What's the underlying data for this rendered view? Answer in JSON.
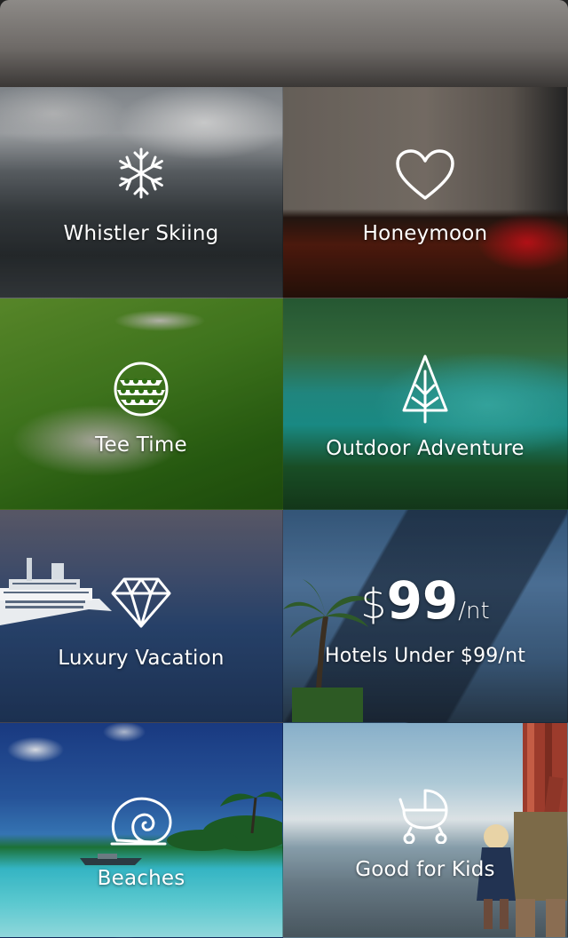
{
  "tiles": [
    {
      "id": "whistler",
      "label": "Whistler Skiing",
      "icon": "snowflake-icon"
    },
    {
      "id": "honeymoon",
      "label": "Honeymoon",
      "icon": "heart-icon"
    },
    {
      "id": "tee",
      "label": "Tee Time",
      "icon": "golf-ball-icon"
    },
    {
      "id": "outdoor",
      "label": "Outdoor Adventure",
      "icon": "tree-icon"
    },
    {
      "id": "luxury",
      "label": "Luxury Vacation",
      "icon": "diamond-icon"
    },
    {
      "id": "hotels",
      "label": "Hotels Under $99/nt",
      "icon": "price-tag",
      "price": {
        "currency": "$",
        "amount": "99",
        "unit": "/nt"
      }
    },
    {
      "id": "beaches",
      "label": "Beaches",
      "icon": "seashell-icon"
    },
    {
      "id": "kids",
      "label": "Good for Kids",
      "icon": "stroller-icon"
    }
  ]
}
